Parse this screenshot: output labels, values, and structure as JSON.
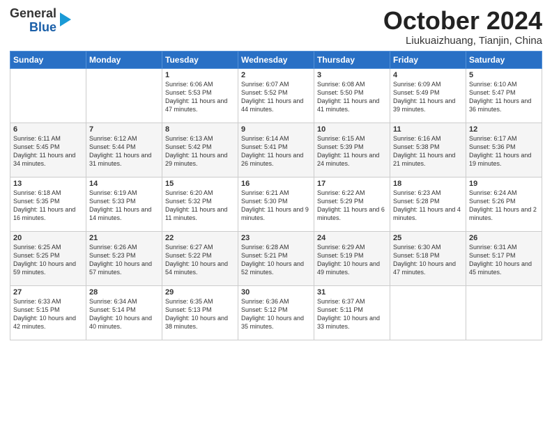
{
  "header": {
    "logo_line1": "General",
    "logo_line2": "Blue",
    "month_title": "October 2024",
    "location": "Liukuaizhuang, Tianjin, China"
  },
  "days_of_week": [
    "Sunday",
    "Monday",
    "Tuesday",
    "Wednesday",
    "Thursday",
    "Friday",
    "Saturday"
  ],
  "weeks": [
    [
      {
        "day": "",
        "info": ""
      },
      {
        "day": "",
        "info": ""
      },
      {
        "day": "1",
        "info": "Sunrise: 6:06 AM\nSunset: 5:53 PM\nDaylight: 11 hours and 47 minutes."
      },
      {
        "day": "2",
        "info": "Sunrise: 6:07 AM\nSunset: 5:52 PM\nDaylight: 11 hours and 44 minutes."
      },
      {
        "day": "3",
        "info": "Sunrise: 6:08 AM\nSunset: 5:50 PM\nDaylight: 11 hours and 41 minutes."
      },
      {
        "day": "4",
        "info": "Sunrise: 6:09 AM\nSunset: 5:49 PM\nDaylight: 11 hours and 39 minutes."
      },
      {
        "day": "5",
        "info": "Sunrise: 6:10 AM\nSunset: 5:47 PM\nDaylight: 11 hours and 36 minutes."
      }
    ],
    [
      {
        "day": "6",
        "info": "Sunrise: 6:11 AM\nSunset: 5:45 PM\nDaylight: 11 hours and 34 minutes."
      },
      {
        "day": "7",
        "info": "Sunrise: 6:12 AM\nSunset: 5:44 PM\nDaylight: 11 hours and 31 minutes."
      },
      {
        "day": "8",
        "info": "Sunrise: 6:13 AM\nSunset: 5:42 PM\nDaylight: 11 hours and 29 minutes."
      },
      {
        "day": "9",
        "info": "Sunrise: 6:14 AM\nSunset: 5:41 PM\nDaylight: 11 hours and 26 minutes."
      },
      {
        "day": "10",
        "info": "Sunrise: 6:15 AM\nSunset: 5:39 PM\nDaylight: 11 hours and 24 minutes."
      },
      {
        "day": "11",
        "info": "Sunrise: 6:16 AM\nSunset: 5:38 PM\nDaylight: 11 hours and 21 minutes."
      },
      {
        "day": "12",
        "info": "Sunrise: 6:17 AM\nSunset: 5:36 PM\nDaylight: 11 hours and 19 minutes."
      }
    ],
    [
      {
        "day": "13",
        "info": "Sunrise: 6:18 AM\nSunset: 5:35 PM\nDaylight: 11 hours and 16 minutes."
      },
      {
        "day": "14",
        "info": "Sunrise: 6:19 AM\nSunset: 5:33 PM\nDaylight: 11 hours and 14 minutes."
      },
      {
        "day": "15",
        "info": "Sunrise: 6:20 AM\nSunset: 5:32 PM\nDaylight: 11 hours and 11 minutes."
      },
      {
        "day": "16",
        "info": "Sunrise: 6:21 AM\nSunset: 5:30 PM\nDaylight: 11 hours and 9 minutes."
      },
      {
        "day": "17",
        "info": "Sunrise: 6:22 AM\nSunset: 5:29 PM\nDaylight: 11 hours and 6 minutes."
      },
      {
        "day": "18",
        "info": "Sunrise: 6:23 AM\nSunset: 5:28 PM\nDaylight: 11 hours and 4 minutes."
      },
      {
        "day": "19",
        "info": "Sunrise: 6:24 AM\nSunset: 5:26 PM\nDaylight: 11 hours and 2 minutes."
      }
    ],
    [
      {
        "day": "20",
        "info": "Sunrise: 6:25 AM\nSunset: 5:25 PM\nDaylight: 10 hours and 59 minutes."
      },
      {
        "day": "21",
        "info": "Sunrise: 6:26 AM\nSunset: 5:23 PM\nDaylight: 10 hours and 57 minutes."
      },
      {
        "day": "22",
        "info": "Sunrise: 6:27 AM\nSunset: 5:22 PM\nDaylight: 10 hours and 54 minutes."
      },
      {
        "day": "23",
        "info": "Sunrise: 6:28 AM\nSunset: 5:21 PM\nDaylight: 10 hours and 52 minutes."
      },
      {
        "day": "24",
        "info": "Sunrise: 6:29 AM\nSunset: 5:19 PM\nDaylight: 10 hours and 49 minutes."
      },
      {
        "day": "25",
        "info": "Sunrise: 6:30 AM\nSunset: 5:18 PM\nDaylight: 10 hours and 47 minutes."
      },
      {
        "day": "26",
        "info": "Sunrise: 6:31 AM\nSunset: 5:17 PM\nDaylight: 10 hours and 45 minutes."
      }
    ],
    [
      {
        "day": "27",
        "info": "Sunrise: 6:33 AM\nSunset: 5:15 PM\nDaylight: 10 hours and 42 minutes."
      },
      {
        "day": "28",
        "info": "Sunrise: 6:34 AM\nSunset: 5:14 PM\nDaylight: 10 hours and 40 minutes."
      },
      {
        "day": "29",
        "info": "Sunrise: 6:35 AM\nSunset: 5:13 PM\nDaylight: 10 hours and 38 minutes."
      },
      {
        "day": "30",
        "info": "Sunrise: 6:36 AM\nSunset: 5:12 PM\nDaylight: 10 hours and 35 minutes."
      },
      {
        "day": "31",
        "info": "Sunrise: 6:37 AM\nSunset: 5:11 PM\nDaylight: 10 hours and 33 minutes."
      },
      {
        "day": "",
        "info": ""
      },
      {
        "day": "",
        "info": ""
      }
    ]
  ]
}
